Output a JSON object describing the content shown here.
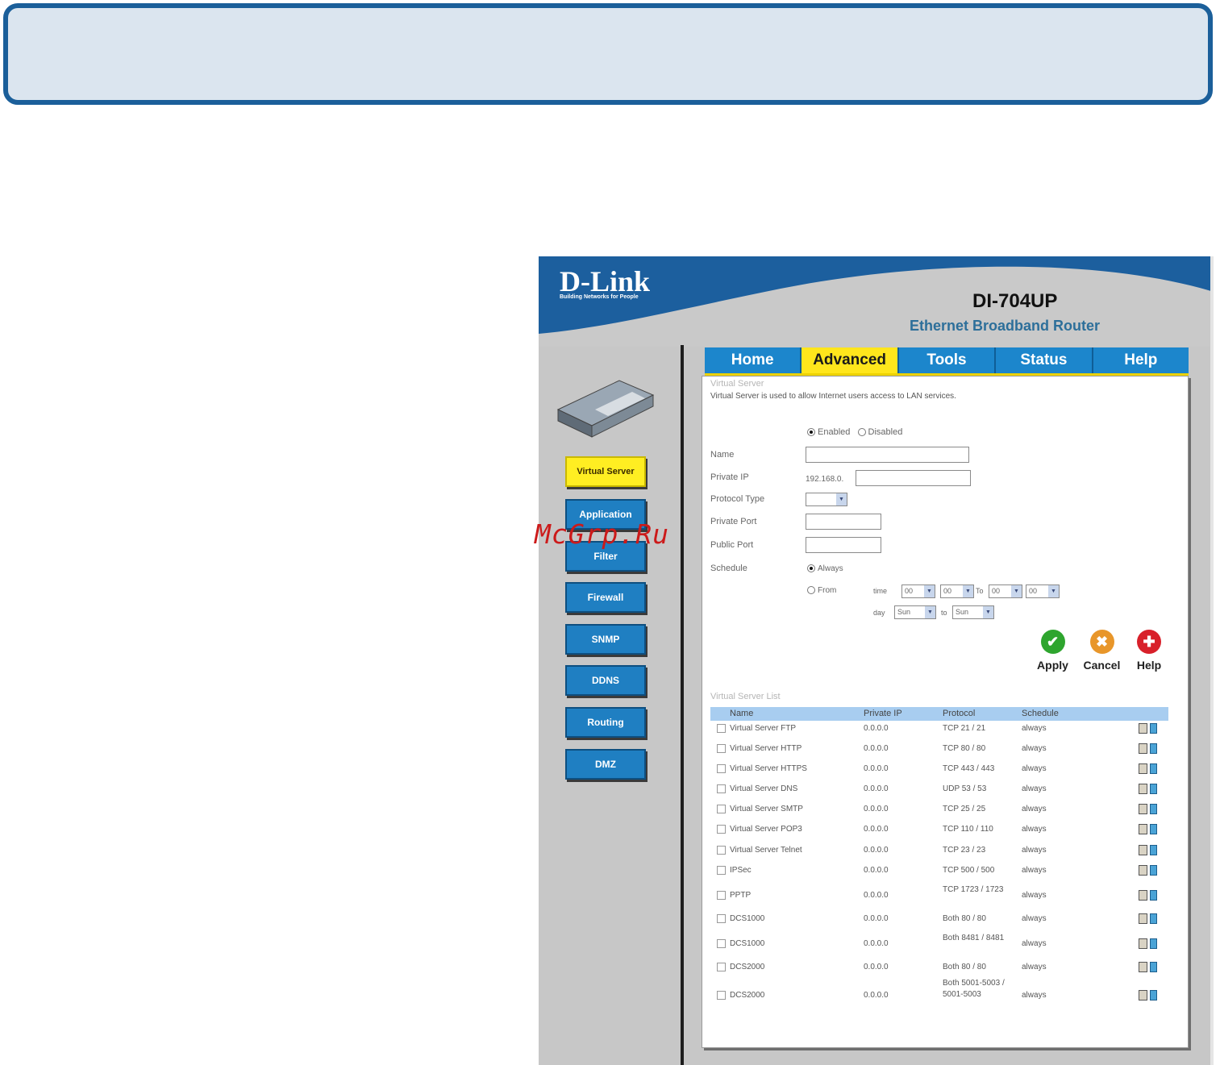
{
  "watermark": "McGrp.Ru",
  "header": {
    "logo": "D-Link",
    "tagline": "Building Networks for People",
    "model": "DI-704UP",
    "subtitle": "Ethernet Broadband Router"
  },
  "nav": {
    "tabs": [
      "Home",
      "Advanced",
      "Tools",
      "Status",
      "Help"
    ],
    "active": "Advanced"
  },
  "sidebar": {
    "items": [
      "Virtual Server",
      "Application",
      "Filter",
      "Firewall",
      "SNMP",
      "DDNS",
      "Routing",
      "DMZ"
    ],
    "active": "Virtual Server"
  },
  "virtual_server": {
    "title": "Virtual Server",
    "description": "Virtual Server is used to allow Internet users access to LAN services.",
    "enabled_label": "Enabled",
    "disabled_label": "Disabled",
    "state": "Enabled",
    "name_label": "Name",
    "private_ip_label": "Private IP",
    "private_ip_prefix": "192.168.0.",
    "protocol_type_label": "Protocol Type",
    "protocol_type_value": "",
    "private_port_label": "Private Port",
    "public_port_label": "Public Port",
    "schedule_label": "Schedule",
    "always_label": "Always",
    "from_label": "From",
    "schedule_mode": "Always",
    "time_label": "time",
    "to_label": "To",
    "day_label": "day",
    "day_to_label": "to",
    "time_from_hour": "00",
    "time_from_min": "00",
    "time_to_hour": "00",
    "time_to_min": "00",
    "day_from": "Sun",
    "day_to": "Sun"
  },
  "actions": {
    "apply": "Apply",
    "cancel": "Cancel",
    "help": "Help",
    "apply_color": "#2ea52e",
    "cancel_color": "#e8962a",
    "help_color": "#d8202a"
  },
  "server_list": {
    "title": "Virtual Server List",
    "columns": [
      "Name",
      "Private IP",
      "Protocol",
      "Schedule"
    ],
    "rows": [
      {
        "name": "Virtual Server FTP",
        "ip": "0.0.0.0",
        "protocol": "TCP 21 / 21",
        "schedule": "always"
      },
      {
        "name": "Virtual Server HTTP",
        "ip": "0.0.0.0",
        "protocol": "TCP 80 / 80",
        "schedule": "always"
      },
      {
        "name": "Virtual Server HTTPS",
        "ip": "0.0.0.0",
        "protocol": "TCP 443 / 443",
        "schedule": "always"
      },
      {
        "name": "Virtual Server DNS",
        "ip": "0.0.0.0",
        "protocol": "UDP 53 / 53",
        "schedule": "always"
      },
      {
        "name": "Virtual Server SMTP",
        "ip": "0.0.0.0",
        "protocol": "TCP 25 / 25",
        "schedule": "always"
      },
      {
        "name": "Virtual Server POP3",
        "ip": "0.0.0.0",
        "protocol": "TCP 110 / 110",
        "schedule": "always"
      },
      {
        "name": "Virtual Server Telnet",
        "ip": "0.0.0.0",
        "protocol": "TCP 23 / 23",
        "schedule": "always"
      },
      {
        "name": "IPSec",
        "ip": "0.0.0.0",
        "protocol": "TCP 500 / 500",
        "schedule": "always"
      },
      {
        "name": "PPTP",
        "ip": "0.0.0.0",
        "protocol": "TCP 1723 / 1723",
        "schedule": "always"
      },
      {
        "name": "DCS1000",
        "ip": "0.0.0.0",
        "protocol": "Both 80 / 80",
        "schedule": "always"
      },
      {
        "name": "DCS1000",
        "ip": "0.0.0.0",
        "protocol": "Both 8481 / 8481",
        "schedule": "always"
      },
      {
        "name": "DCS2000",
        "ip": "0.0.0.0",
        "protocol": "Both 80 / 80",
        "schedule": "always"
      },
      {
        "name": "DCS2000",
        "ip": "0.0.0.0",
        "protocol": "Both 5001-5003 / 5001-5003",
        "schedule": "always"
      }
    ]
  },
  "colors": {
    "banner_border": "#1b5f9a",
    "banner_fill": "#dbe5ef",
    "header_blue": "#1c5f9e",
    "nav_blue": "#1c86cc",
    "nav_active": "#ffe61c",
    "sidebar_blue": "#1f7fc2",
    "sidebar_active": "#ffee22"
  }
}
